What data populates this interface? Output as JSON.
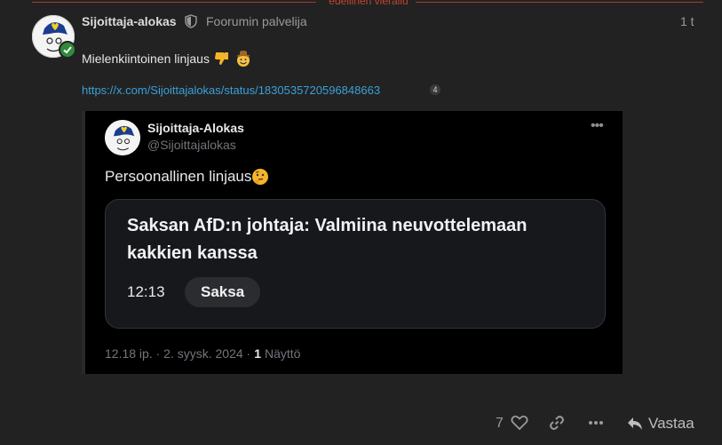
{
  "divider": {
    "label": "edellinen vierailu"
  },
  "post": {
    "username": "Sijoittaja-alokas",
    "user_title": "Foorumin palvelija",
    "date": "1 t",
    "text": "Mielenkiintoinen linjaus",
    "text_emojis": [
      "thumbs-down-icon",
      "cowboy-face-icon"
    ],
    "link": "https://x.com/Sijoittajalokas/status/1830535720596848663",
    "link_clicks": "4"
  },
  "tweet": {
    "display_name": "Sijoittaja-Alokas",
    "handle": "@Sijoittajalokas",
    "text": "Persoonallinen linjaus",
    "card": {
      "headline": "Saksan AfD:n johtaja: Valmiina neuvottelemaan kakkien kanssa",
      "time": "12:13",
      "tag": "Saksa"
    },
    "timestamp": "12.18 ip. · 2. syysk. 2024 ·",
    "views_count": "1",
    "views_label": "Näyttö"
  },
  "controls": {
    "like_count": "7",
    "reply_label": "Vastaa"
  },
  "colors": {
    "background": "#222222",
    "link": "#3ba0d8",
    "accent_red": "#c0452f"
  }
}
